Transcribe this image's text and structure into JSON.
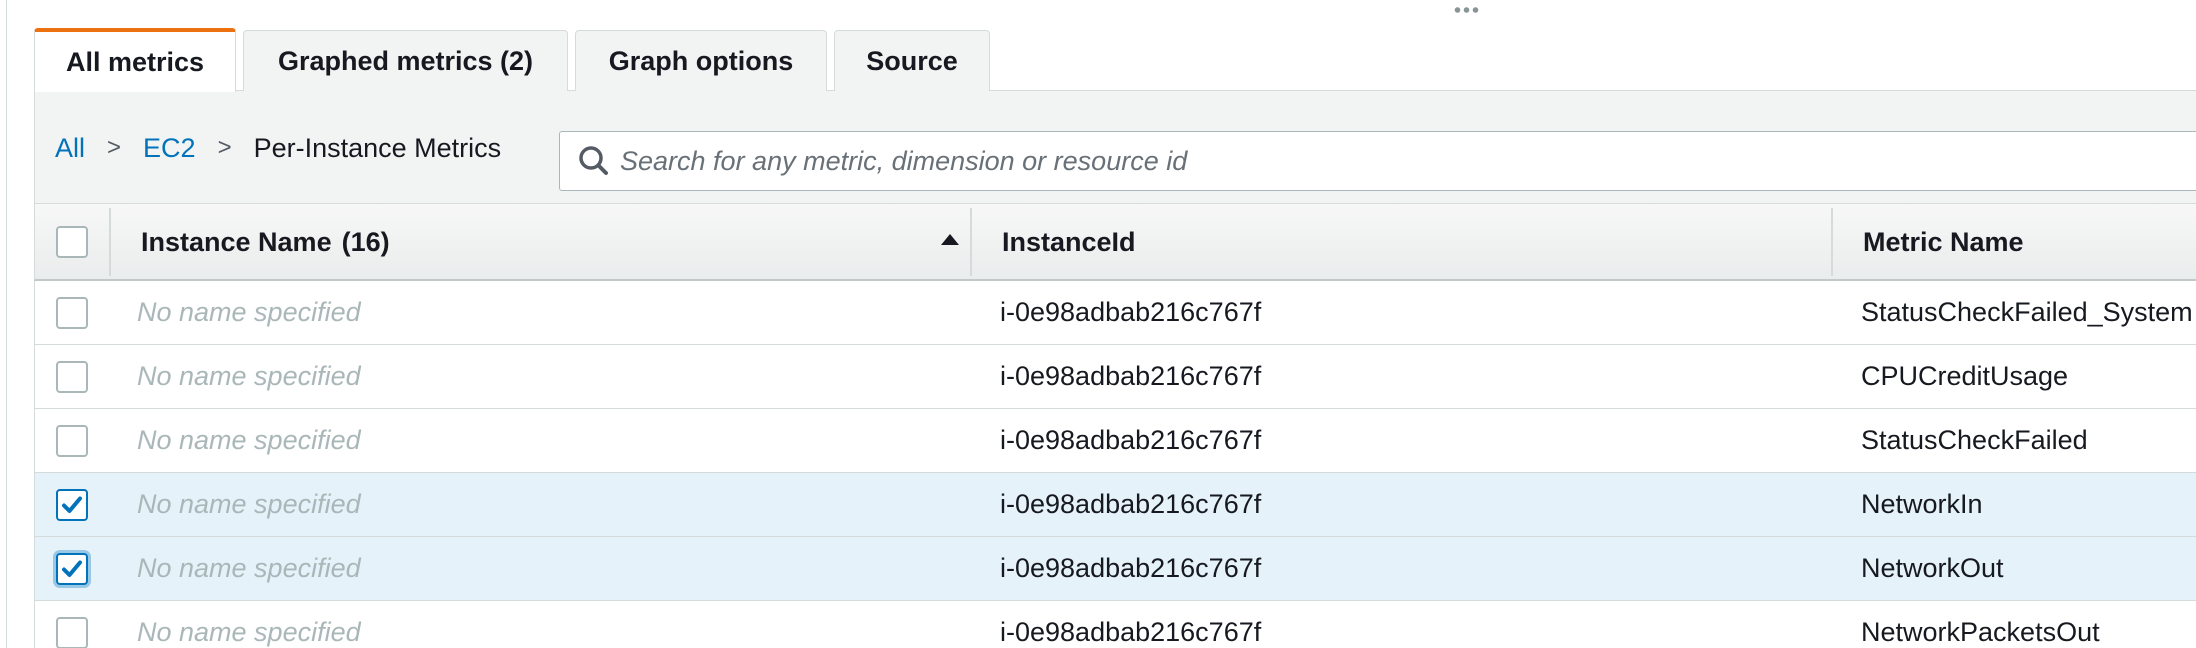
{
  "tabs": [
    {
      "label": "All metrics",
      "active": true
    },
    {
      "label": "Graphed metrics (2)",
      "active": false
    },
    {
      "label": "Graph options",
      "active": false
    },
    {
      "label": "Source",
      "active": false
    }
  ],
  "breadcrumb": {
    "items": [
      {
        "label": "All",
        "link": true
      },
      {
        "label": "EC2",
        "link": true
      },
      {
        "label": "Per-Instance Metrics",
        "link": false
      }
    ],
    "separator": ">"
  },
  "search": {
    "placeholder": "Search for any metric, dimension or resource id",
    "value": ""
  },
  "table": {
    "columns": {
      "name": "Instance Name",
      "name_count": "(16)",
      "instance_id": "InstanceId",
      "metric": "Metric Name"
    },
    "sort": "ascending",
    "rows": [
      {
        "name": "No name specified",
        "instance_id": "i-0e98adbab216c767f",
        "metric": "StatusCheckFailed_System",
        "checked": false
      },
      {
        "name": "No name specified",
        "instance_id": "i-0e98adbab216c767f",
        "metric": "CPUCreditUsage",
        "checked": false
      },
      {
        "name": "No name specified",
        "instance_id": "i-0e98adbab216c767f",
        "metric": "StatusCheckFailed",
        "checked": false
      },
      {
        "name": "No name specified",
        "instance_id": "i-0e98adbab216c767f",
        "metric": "NetworkIn",
        "checked": true
      },
      {
        "name": "No name specified",
        "instance_id": "i-0e98adbab216c767f",
        "metric": "NetworkOut",
        "checked": true
      },
      {
        "name": "No name specified",
        "instance_id": "i-0e98adbab216c767f",
        "metric": "NetworkPacketsOut",
        "checked": false
      }
    ]
  },
  "colors": {
    "accent_tab": "#ec7211",
    "link": "#0073bb",
    "selected_row": "#e6f2fa",
    "check": "#0073bb"
  },
  "icons": {
    "search": "search-icon",
    "sort": "sort-ascending-icon",
    "drag": "drag-handle-icon",
    "check": "checkmark-icon"
  }
}
